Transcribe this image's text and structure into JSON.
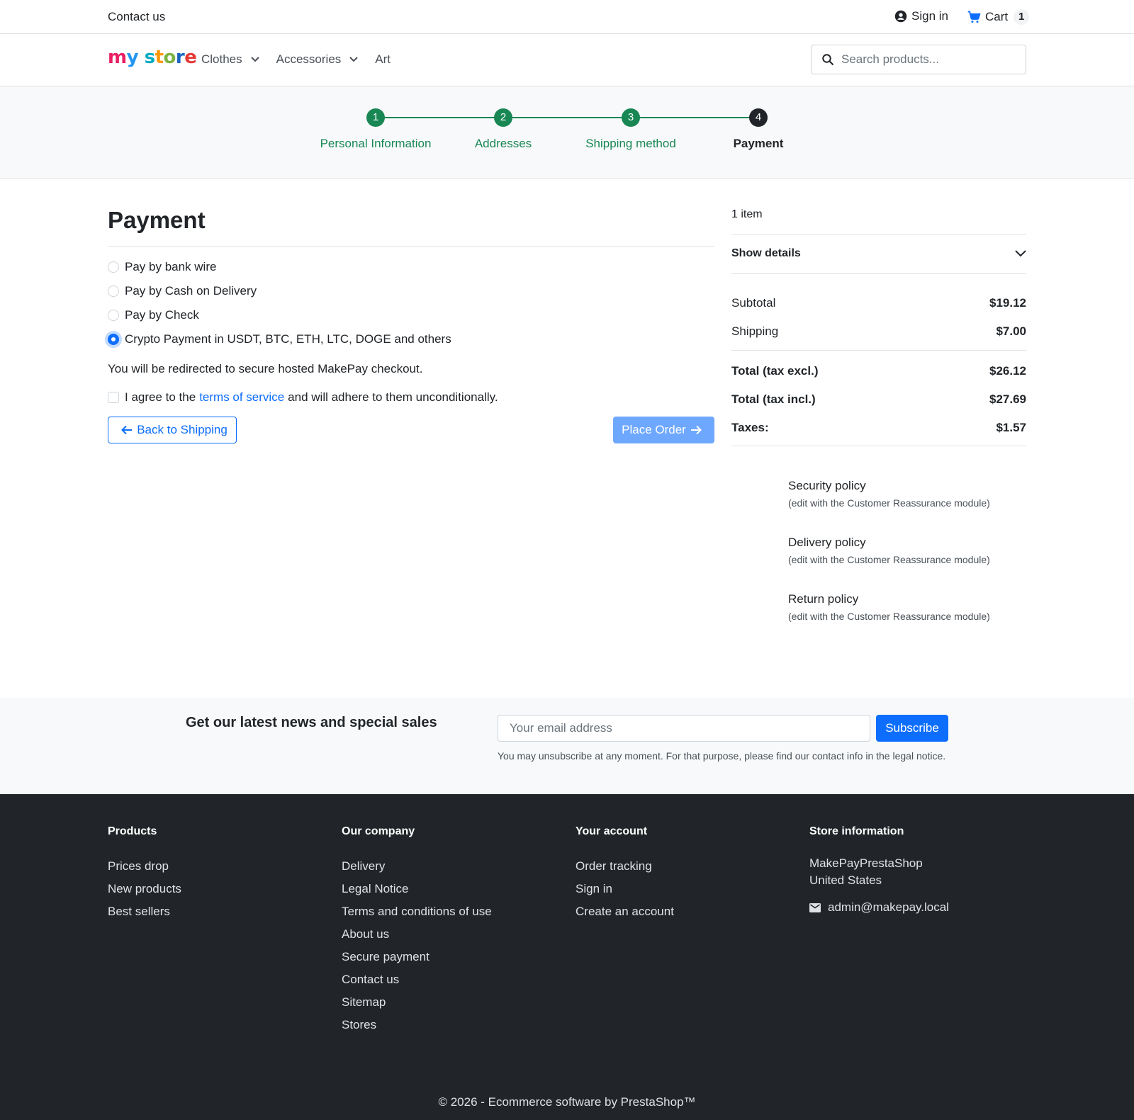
{
  "topbar": {
    "contact": "Contact us",
    "sign_in": "Sign in",
    "cart_label": "Cart",
    "cart_count": "1"
  },
  "header": {
    "logo_text": [
      "m",
      "y",
      " ",
      "s",
      "t",
      "o",
      "r",
      "e"
    ],
    "nav": [
      {
        "label": "Clothes",
        "has_dropdown": true
      },
      {
        "label": "Accessories",
        "has_dropdown": true
      },
      {
        "label": "Art",
        "has_dropdown": false
      }
    ],
    "search_placeholder": "Search products..."
  },
  "stepper": {
    "steps": [
      {
        "number": "1",
        "label": "Personal Information",
        "status": "done"
      },
      {
        "number": "2",
        "label": "Addresses",
        "status": "done"
      },
      {
        "number": "3",
        "label": "Shipping method",
        "status": "done"
      },
      {
        "number": "4",
        "label": "Payment",
        "status": "current"
      }
    ]
  },
  "payment": {
    "title": "Payment",
    "options": [
      {
        "label": "Pay by bank wire",
        "selected": false
      },
      {
        "label": "Pay by Cash on Delivery",
        "selected": false
      },
      {
        "label": "Pay by Check",
        "selected": false
      },
      {
        "label": "Crypto Payment in USDT, BTC, ETH, LTC, DOGE and others",
        "selected": true
      }
    ],
    "redirect_note": "You will be redirected to secure hosted MakePay checkout.",
    "agree_prefix": "I agree to the",
    "agree_link": "terms of service",
    "agree_suffix": "and will adhere to them unconditionally.",
    "back_button": "Back to Shipping",
    "place_order_button": "Place Order"
  },
  "summary": {
    "items_count": "1 item",
    "show_details": "Show details",
    "subtotal_label": "Subtotal",
    "subtotal": "$19.12",
    "shipping_label": "Shipping",
    "shipping": "$7.00",
    "total_excl_label": "Total (tax excl.)",
    "total_excl": "$26.12",
    "total_incl_label": "Total (tax incl.)",
    "total_incl": "$27.69",
    "taxes_label": "Taxes:",
    "taxes": "$1.57"
  },
  "reassurance": [
    {
      "title": "Security policy",
      "note": "(edit with the Customer Reassurance module)"
    },
    {
      "title": "Delivery policy",
      "note": "(edit with the Customer Reassurance module)"
    },
    {
      "title": "Return policy",
      "note": "(edit with the Customer Reassurance module)"
    }
  ],
  "newsletter": {
    "title": "Get our latest news and special sales",
    "email_placeholder": "Your email address",
    "subscribe_button": "Subscribe",
    "note": "You may unsubscribe at any moment. For that purpose, please find our contact info in the legal notice."
  },
  "footer": {
    "products": {
      "heading": "Products",
      "links": [
        "Prices drop",
        "New products",
        "Best sellers"
      ]
    },
    "company": {
      "heading": "Our company",
      "links": [
        "Delivery",
        "Legal Notice",
        "Terms and conditions of use",
        "About us",
        "Secure payment",
        "Contact us",
        "Sitemap",
        "Stores"
      ]
    },
    "account": {
      "heading": "Your account",
      "links": [
        "Order tracking",
        "Sign in",
        "Create an account"
      ]
    },
    "store": {
      "heading": "Store information",
      "name": "MakePayPrestaShop",
      "country": "United States",
      "email": "admin@makepay.local"
    },
    "copyright": "© 2026 - Ecommerce software by PrestaShop™"
  },
  "colors": {
    "accent": "#0d6efd",
    "success": "#198754",
    "footer_bg": "#212529"
  }
}
